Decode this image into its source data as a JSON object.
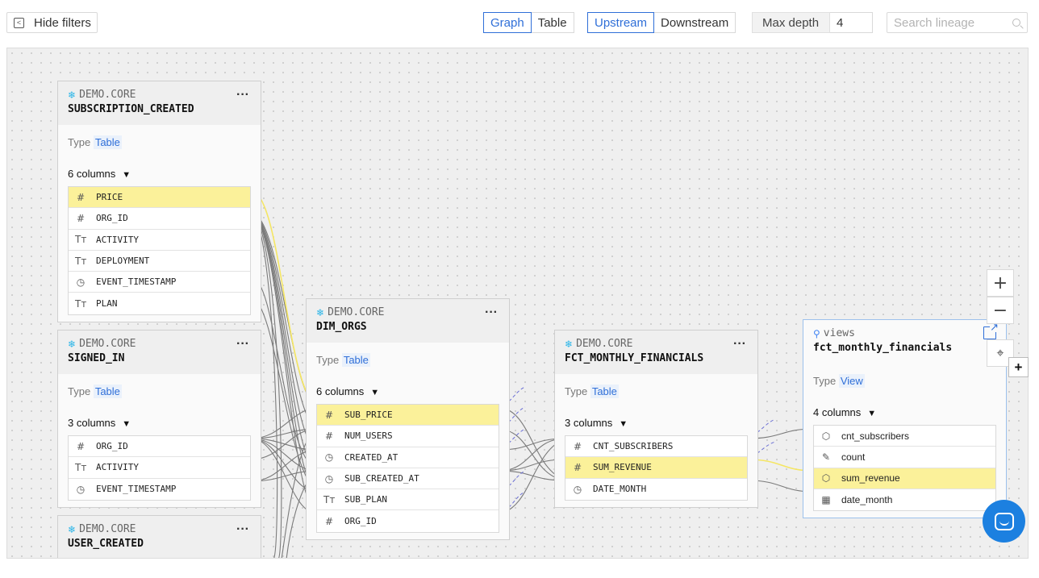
{
  "toolbar": {
    "hide_filters": "Hide filters",
    "view_tabs": [
      "Graph",
      "Table"
    ],
    "direction_tabs": [
      "Upstream",
      "Downstream"
    ],
    "max_depth_label": "Max depth",
    "max_depth_value": "4",
    "search_placeholder": "Search lineage"
  },
  "nodes": {
    "subscription_created": {
      "db": "DEMO.CORE",
      "name": "SUBSCRIPTION_CREATED",
      "type_label": "Type",
      "type": "Table",
      "columns_label": "6 columns",
      "columns": [
        {
          "name": "PRICE",
          "icon": "hash-icon",
          "glyph": "#"
        },
        {
          "name": "ORG_ID",
          "icon": "hash-icon",
          "glyph": "#"
        },
        {
          "name": "ACTIVITY",
          "icon": "text-icon",
          "glyph": "Tт"
        },
        {
          "name": "DEPLOYMENT",
          "icon": "text-icon",
          "glyph": "Tт"
        },
        {
          "name": "EVENT_TIMESTAMP",
          "icon": "clock-icon",
          "glyph": "◷"
        },
        {
          "name": "PLAN",
          "icon": "text-icon",
          "glyph": "Tт"
        }
      ]
    },
    "signed_in": {
      "db": "DEMO.CORE",
      "name": "SIGNED_IN",
      "type_label": "Type",
      "type": "Table",
      "columns_label": "3 columns",
      "columns": [
        {
          "name": "ORG_ID",
          "icon": "hash-icon",
          "glyph": "#"
        },
        {
          "name": "ACTIVITY",
          "icon": "text-icon",
          "glyph": "Tт"
        },
        {
          "name": "EVENT_TIMESTAMP",
          "icon": "clock-icon",
          "glyph": "◷"
        }
      ]
    },
    "user_created": {
      "db": "DEMO.CORE",
      "name": "USER_CREATED"
    },
    "dim_orgs": {
      "db": "DEMO.CORE",
      "name": "DIM_ORGS",
      "type_label": "Type",
      "type": "Table",
      "columns_label": "6 columns",
      "columns": [
        {
          "name": "SUB_PRICE",
          "icon": "hash-icon",
          "glyph": "#"
        },
        {
          "name": "NUM_USERS",
          "icon": "hash-icon",
          "glyph": "#"
        },
        {
          "name": "CREATED_AT",
          "icon": "clock-icon",
          "glyph": "◷"
        },
        {
          "name": "SUB_CREATED_AT",
          "icon": "clock-icon",
          "glyph": "◷"
        },
        {
          "name": "SUB_PLAN",
          "icon": "text-icon",
          "glyph": "Tт"
        },
        {
          "name": "ORG_ID",
          "icon": "hash-icon",
          "glyph": "#"
        }
      ]
    },
    "fct_monthly_financials": {
      "db": "DEMO.CORE",
      "name": "FCT_MONTHLY_FINANCIALS",
      "type_label": "Type",
      "type": "Table",
      "columns_label": "3 columns",
      "columns": [
        {
          "name": "CNT_SUBSCRIBERS",
          "icon": "hash-icon",
          "glyph": "#"
        },
        {
          "name": "SUM_REVENUE",
          "icon": "hash-icon",
          "glyph": "#"
        },
        {
          "name": "DATE_MONTH",
          "icon": "clock-icon",
          "glyph": "◷"
        }
      ]
    },
    "view_fct_monthly_financials": {
      "db": "views",
      "name": "fct_monthly_financials",
      "type_label": "Type",
      "type": "View",
      "columns_label": "4 columns",
      "columns": [
        {
          "name": "cnt_subscribers",
          "icon": "cube-icon",
          "glyph": "⬡"
        },
        {
          "name": "count",
          "icon": "ruler-icon",
          "glyph": "✎"
        },
        {
          "name": "sum_revenue",
          "icon": "cube-icon",
          "glyph": "⬡"
        },
        {
          "name": "date_month",
          "icon": "calendar-icon",
          "glyph": "▦"
        }
      ]
    }
  },
  "controls": {
    "zoom_in": "+",
    "zoom_out": "−",
    "fit": "⌖",
    "expand": "+"
  },
  "colors": {
    "accent": "#2f6fd8",
    "highlight": "#fbf19a",
    "edge": "#777777",
    "edge_highlight": "#f5e663",
    "edge_dashed": "#6b6fd4"
  }
}
